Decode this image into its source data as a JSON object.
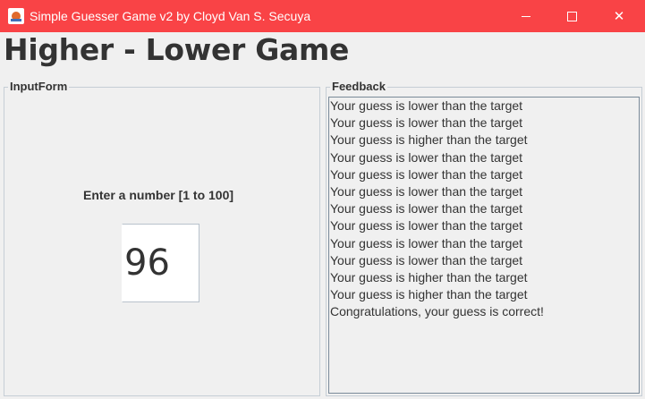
{
  "window": {
    "title": "Simple Guesser Game v2 by Cloyd Van S. Secuya",
    "accent": "#f94346"
  },
  "heading": "Higher - Lower Game",
  "input_form": {
    "legend": "InputForm",
    "prompt": "Enter a number [1 to 100]",
    "value": "96"
  },
  "feedback": {
    "legend": "Feedback",
    "lines": [
      "Your guess is lower than the target",
      "Your guess is lower than the target",
      "Your guess is higher than the target",
      "Your guess is lower than the target",
      "Your guess is lower than the target",
      "Your guess is lower than the target",
      "Your guess is lower than the target",
      "Your guess is lower than the target",
      "Your guess is lower than the target",
      "Your guess is lower than the target",
      "Your guess is higher than the target",
      "Your guess is higher than the target",
      "Congratulations, your guess is correct!"
    ]
  }
}
